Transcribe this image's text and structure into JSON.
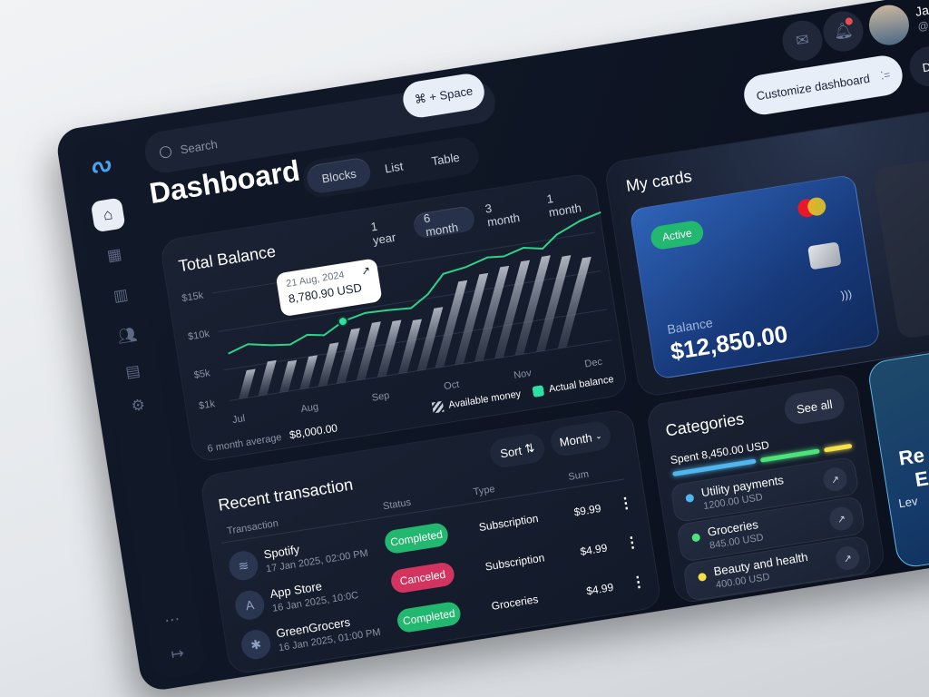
{
  "header": {
    "search_placeholder": "Search",
    "shortcut": "⌘ + Space",
    "customize": "Customize dashboard",
    "extra_button": "D",
    "user": {
      "name": "Jack",
      "handle": "@jac"
    }
  },
  "sidebar": {
    "items": [
      {
        "icon": "home-icon",
        "active": true
      },
      {
        "icon": "grid-icon"
      },
      {
        "icon": "chart-icon"
      },
      {
        "icon": "users-icon"
      },
      {
        "icon": "calendar-icon"
      },
      {
        "icon": "gear-icon"
      }
    ],
    "bottom": [
      {
        "icon": "chat-icon"
      },
      {
        "icon": "logout-icon"
      }
    ]
  },
  "page": {
    "title": "Dashboard",
    "views": [
      "Blocks",
      "List",
      "Table"
    ],
    "active_view": "Blocks"
  },
  "balance": {
    "title": "Total Balance",
    "periods": [
      "1 year",
      "6 month",
      "3 month",
      "1 month"
    ],
    "active_period": "6 month",
    "tooltip": {
      "date": "21 Aug, 2024",
      "value": "8,780.90 USD"
    },
    "avg_label": "6 month average",
    "avg_value": "$8,000.00",
    "legend": [
      "Available money",
      "Actual balance"
    ]
  },
  "chart_data": {
    "type": "line",
    "xlabels": [
      "Jul",
      "Aug",
      "Sep",
      "Oct",
      "Nov",
      "Dec"
    ],
    "yticks": [
      {
        "label": "$15k",
        "value": 15000
      },
      {
        "label": "$10k",
        "value": 10000
      },
      {
        "label": "$5k",
        "value": 5000
      },
      {
        "label": "$1k",
        "value": 1000
      }
    ],
    "ylim": [
      1000,
      15000
    ],
    "grid": true,
    "legend_placement": "bottom-right",
    "series": [
      {
        "name": "Actual balance",
        "type": "line",
        "color": "#2fd08a",
        "points": [
          [
            "2024-07-01",
            7000
          ],
          [
            "2024-07-10",
            7800
          ],
          [
            "2024-07-20",
            7200
          ],
          [
            "2024-07-28",
            6900
          ],
          [
            "2024-08-05",
            7800
          ],
          [
            "2024-08-12",
            7400
          ],
          [
            "2024-08-21",
            8780.9
          ],
          [
            "2024-08-31",
            9400
          ],
          [
            "2024-09-10",
            9300
          ],
          [
            "2024-09-20",
            9100
          ],
          [
            "2024-09-28",
            10500
          ],
          [
            "2024-10-05",
            12800
          ],
          [
            "2024-10-15",
            13200
          ],
          [
            "2024-10-25",
            14000
          ],
          [
            "2024-11-01",
            13800
          ],
          [
            "2024-11-10",
            14500
          ],
          [
            "2024-11-18",
            14000
          ],
          [
            "2024-11-25",
            15500
          ],
          [
            "2024-12-05",
            16800
          ],
          [
            "2024-12-15",
            17500
          ],
          [
            "2024-12-20",
            18200
          ]
        ]
      },
      {
        "name": "Available money",
        "type": "bar",
        "color": "#c9ced8",
        "points": [
          [
            "2024-07-05",
            4500
          ],
          [
            "2024-07-14",
            5200
          ],
          [
            "2024-07-23",
            4800
          ],
          [
            "2024-08-01",
            5000
          ],
          [
            "2024-08-10",
            6200
          ],
          [
            "2024-08-19",
            7600
          ],
          [
            "2024-08-28",
            8000
          ],
          [
            "2024-09-06",
            7800
          ],
          [
            "2024-09-15",
            7500
          ],
          [
            "2024-09-24",
            8600
          ],
          [
            "2024-10-03",
            11500
          ],
          [
            "2024-10-12",
            12000
          ],
          [
            "2024-10-21",
            12500
          ],
          [
            "2024-10-30",
            12800
          ],
          [
            "2024-11-08",
            13000
          ],
          [
            "2024-11-17",
            12600
          ],
          [
            "2024-11-26",
            12000
          ]
        ]
      }
    ],
    "highlight": {
      "date": "2024-08-21",
      "value": 8780.9
    }
  },
  "transactions": {
    "title": "Recent transaction",
    "sort": "Sort",
    "period": "Month",
    "columns": [
      "Transaction",
      "Status",
      "Type",
      "Sum"
    ],
    "rows": [
      {
        "name": "Spotify",
        "date": "17 Jan 2025, 02:00 PM",
        "status": "Completed",
        "type": "Subscription",
        "sum": "$9.99",
        "icon": "spotify-icon"
      },
      {
        "name": "App Store",
        "date": "16 Jan 2025, 10:0C",
        "status": "Canceled",
        "type": "Subscription",
        "sum": "$4.99",
        "icon": "app-store-icon"
      },
      {
        "name": "GreenGrocers",
        "date": "16 Jan 2025, 01:00 PM",
        "status": "Completed",
        "type": "Groceries",
        "sum": "$4.99",
        "icon": "grocer-icon"
      }
    ]
  },
  "cards": {
    "title": "My cards",
    "status": "Active",
    "balance_label": "Balance",
    "balance": "$12,850.00"
  },
  "categories": {
    "title": "Categories",
    "see_all": "See all",
    "spent": "Spent 8,450.00 USD",
    "items": [
      {
        "name": "Utility payments",
        "amount": "1200.00 USD",
        "color": "#4fb6ee"
      },
      {
        "name": "Groceries",
        "amount": "845.00 USD",
        "color": "#4ee27a"
      },
      {
        "name": "Beauty and health",
        "amount": "400.00 USD",
        "color": "#f5e04a"
      }
    ]
  },
  "promo": {
    "line1": "Re",
    "line2": "E",
    "line3": "Lev"
  },
  "colors": {
    "completed": "#22b86f",
    "canceled": "#d2345f",
    "accent": "#2fd08a"
  }
}
